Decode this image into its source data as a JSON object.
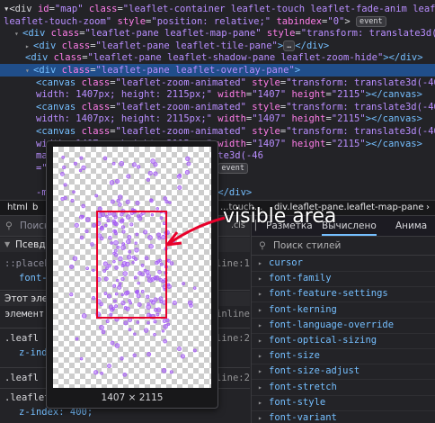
{
  "tree": {
    "lines": [
      {
        "indent": 0,
        "parts": [
          [
            "txt",
            "▾<div "
          ],
          [
            "attr",
            "id"
          ],
          [
            "txt",
            "="
          ],
          [
            "val",
            "\"map\""
          ],
          [
            "txt",
            " "
          ],
          [
            "attr",
            "class"
          ],
          [
            "txt",
            "="
          ],
          [
            "val",
            "\"leaflet-container leaflet-touch leaflet-fade-anim leaflet-grab"
          ]
        ]
      },
      {
        "indent": 0,
        "parts": [
          [
            "val",
            "leaflet-touch-zoom\""
          ],
          [
            "txt",
            " "
          ],
          [
            "attr",
            "style"
          ],
          [
            "txt",
            "="
          ],
          [
            "val",
            "\"position: relative;\""
          ],
          [
            "txt",
            " "
          ],
          [
            "attr",
            "tabindex"
          ],
          [
            "txt",
            "="
          ],
          [
            "val",
            "\"0\""
          ],
          [
            "txt",
            "> "
          ],
          [
            "badge",
            "event"
          ]
        ]
      },
      {
        "indent": 1,
        "parts": [
          [
            "tw",
            "▾"
          ],
          [
            "tag",
            "<div "
          ],
          [
            "attr",
            "class"
          ],
          [
            "txt",
            "="
          ],
          [
            "val",
            "\"leaflet-pane leaflet-map-pane\""
          ],
          [
            "txt",
            " "
          ],
          [
            "attr",
            "style"
          ],
          [
            "txt",
            "="
          ],
          [
            "val",
            "\"transform: translate3d(0"
          ]
        ]
      },
      {
        "indent": 2,
        "parts": [
          [
            "tw",
            "▸"
          ],
          [
            "tag",
            "<div "
          ],
          [
            "attr",
            "class"
          ],
          [
            "txt",
            "="
          ],
          [
            "val",
            "\"leaflet-pane leaflet-tile-pane\""
          ],
          [
            "tag",
            ">"
          ],
          [
            "badge",
            "…"
          ],
          [
            "tag",
            "</div>"
          ]
        ]
      },
      {
        "indent": 2,
        "parts": [
          [
            "tag",
            "<div "
          ],
          [
            "attr",
            "class"
          ],
          [
            "txt",
            "="
          ],
          [
            "val",
            "\"leaflet-pane leaflet-shadow-pane leaflet-zoom-hide\""
          ],
          [
            "tag",
            "></div>"
          ]
        ]
      },
      {
        "indent": 2,
        "sel": true,
        "parts": [
          [
            "tw",
            "▾"
          ],
          [
            "tag",
            "<div "
          ],
          [
            "attr",
            "class"
          ],
          [
            "txt",
            "="
          ],
          [
            "val",
            "\"leaflet-pane leaflet-overlay-pane\""
          ],
          [
            "tag",
            ">"
          ]
        ]
      },
      {
        "indent": 3,
        "parts": [
          [
            "tag",
            "<canvas "
          ],
          [
            "attr",
            "class"
          ],
          [
            "txt",
            "="
          ],
          [
            "val",
            "\"leaflet-zoom-animated\""
          ],
          [
            "txt",
            " "
          ],
          [
            "attr",
            "style"
          ],
          [
            "txt",
            "="
          ],
          [
            "val",
            "\"transform: translate3d(-46"
          ]
        ]
      },
      {
        "indent": 3,
        "parts": [
          [
            "val",
            "width: 1407px; height: 2115px;\""
          ],
          [
            "txt",
            " "
          ],
          [
            "attr",
            "width"
          ],
          [
            "txt",
            "="
          ],
          [
            "val",
            "\"1407\""
          ],
          [
            "txt",
            " "
          ],
          [
            "attr",
            "height"
          ],
          [
            "txt",
            "="
          ],
          [
            "val",
            "\"2115\""
          ],
          [
            "tag",
            "></canvas>"
          ]
        ]
      },
      {
        "indent": 3,
        "parts": [
          [
            "tag",
            "<canvas "
          ],
          [
            "attr",
            "class"
          ],
          [
            "txt",
            "="
          ],
          [
            "val",
            "\"leaflet-zoom-animated\""
          ],
          [
            "txt",
            " "
          ],
          [
            "attr",
            "style"
          ],
          [
            "txt",
            "="
          ],
          [
            "val",
            "\"transform: translate3d(-46"
          ]
        ]
      },
      {
        "indent": 3,
        "parts": [
          [
            "val",
            "width: 1407px; height: 2115px;\""
          ],
          [
            "txt",
            " "
          ],
          [
            "attr",
            "width"
          ],
          [
            "txt",
            "="
          ],
          [
            "val",
            "\"1407\""
          ],
          [
            "txt",
            " "
          ],
          [
            "attr",
            "height"
          ],
          [
            "txt",
            "="
          ],
          [
            "val",
            "\"2115\""
          ],
          [
            "tag",
            "></canvas>"
          ]
        ]
      },
      {
        "indent": 3,
        "parts": [
          [
            "tag",
            "<canvas "
          ],
          [
            "attr",
            "class"
          ],
          [
            "txt",
            "="
          ],
          [
            "val",
            "\"leaflet-zoom-animated\""
          ],
          [
            "txt",
            " "
          ],
          [
            "attr",
            "style"
          ],
          [
            "txt",
            "="
          ],
          [
            "val",
            "\"transform: translate3d(-46"
          ]
        ]
      },
      {
        "indent": 3,
        "parts": [
          [
            "val",
            "width: 1407px; height: 2115px;\""
          ],
          [
            "txt",
            " "
          ],
          [
            "attr",
            "width"
          ],
          [
            "txt",
            "="
          ],
          [
            "val",
            "\"1407\""
          ],
          [
            "txt",
            " "
          ],
          [
            "attr",
            "height"
          ],
          [
            "txt",
            "="
          ],
          [
            "val",
            "\"2115\""
          ],
          [
            "tag",
            "></canvas>"
          ]
        ]
      },
      {
        "indent": 3,
        "parts": [
          [
            "txt",
            "                          "
          ],
          [
            "val",
            "mated\""
          ],
          [
            "txt",
            " "
          ],
          [
            "attr",
            "style"
          ],
          [
            "txt",
            "="
          ],
          [
            "val",
            "\"transform: translate3d(-46"
          ]
        ]
      },
      {
        "indent": 3,
        "parts": [
          [
            "txt",
            "                          "
          ],
          [
            "val",
            "=\"1407\""
          ],
          [
            "txt",
            " "
          ],
          [
            "attr",
            "height"
          ],
          [
            "txt",
            "="
          ],
          [
            "val",
            "\"2115\""
          ],
          [
            "tag",
            "></canvas>"
          ],
          [
            "txt",
            " "
          ],
          [
            "badge",
            "event"
          ]
        ]
      },
      {
        "indent": 3,
        "parts": [
          [
            "txt",
            " "
          ]
        ]
      },
      {
        "indent": 3,
        "parts": [
          [
            "txt",
            "                          "
          ],
          [
            "val",
            "-marker-pane leaflet-zoom-hide\""
          ],
          [
            "tag",
            "></div>"
          ]
        ]
      }
    ]
  },
  "breadcrumb": {
    "left": "html",
    "left2": "b",
    "mid": "...touch...",
    "right": "div.leaflet-pane.leaflet-map-pane",
    "more": "›"
  },
  "left_panel": {
    "search_placeholder": "Поиск",
    "pseudo_label": "Псевдо",
    "rule1_selector": "::placeh",
    "rule1_prop": "font-",
    "rule1_source": "line:1",
    "element_label": "Этот элем",
    "element_rule": "элемент",
    "element_source": "inline",
    "rule2_selector": ".leafl",
    "rule2_prop": "z-ind",
    "rule2_source": "line:2",
    "rule3_selector": ".leafl",
    "rule3_source": "line:2",
    "rule4_selector": ".leaflet-pane",
    "rule4_prop": "z-index: 400;",
    "cls_label": ".cls"
  },
  "right_panel": {
    "tabs": [
      "Разметка",
      "Вычислено",
      "Анима"
    ],
    "active_tab": 1,
    "filter_placeholder": "Поиск стилей",
    "properties": [
      "cursor",
      "font-family",
      "font-feature-settings",
      "font-kerning",
      "font-language-override",
      "font-optical-sizing",
      "font-size",
      "font-size-adjust",
      "font-stretch",
      "font-style",
      "font-variant"
    ]
  },
  "tooltip": {
    "dimensions": "1407 × 2115"
  },
  "annotation": {
    "caption": "visible area",
    "color": "#e8002a"
  },
  "colors": {
    "dot": "#a55cf5",
    "selection": "#204e8a"
  }
}
